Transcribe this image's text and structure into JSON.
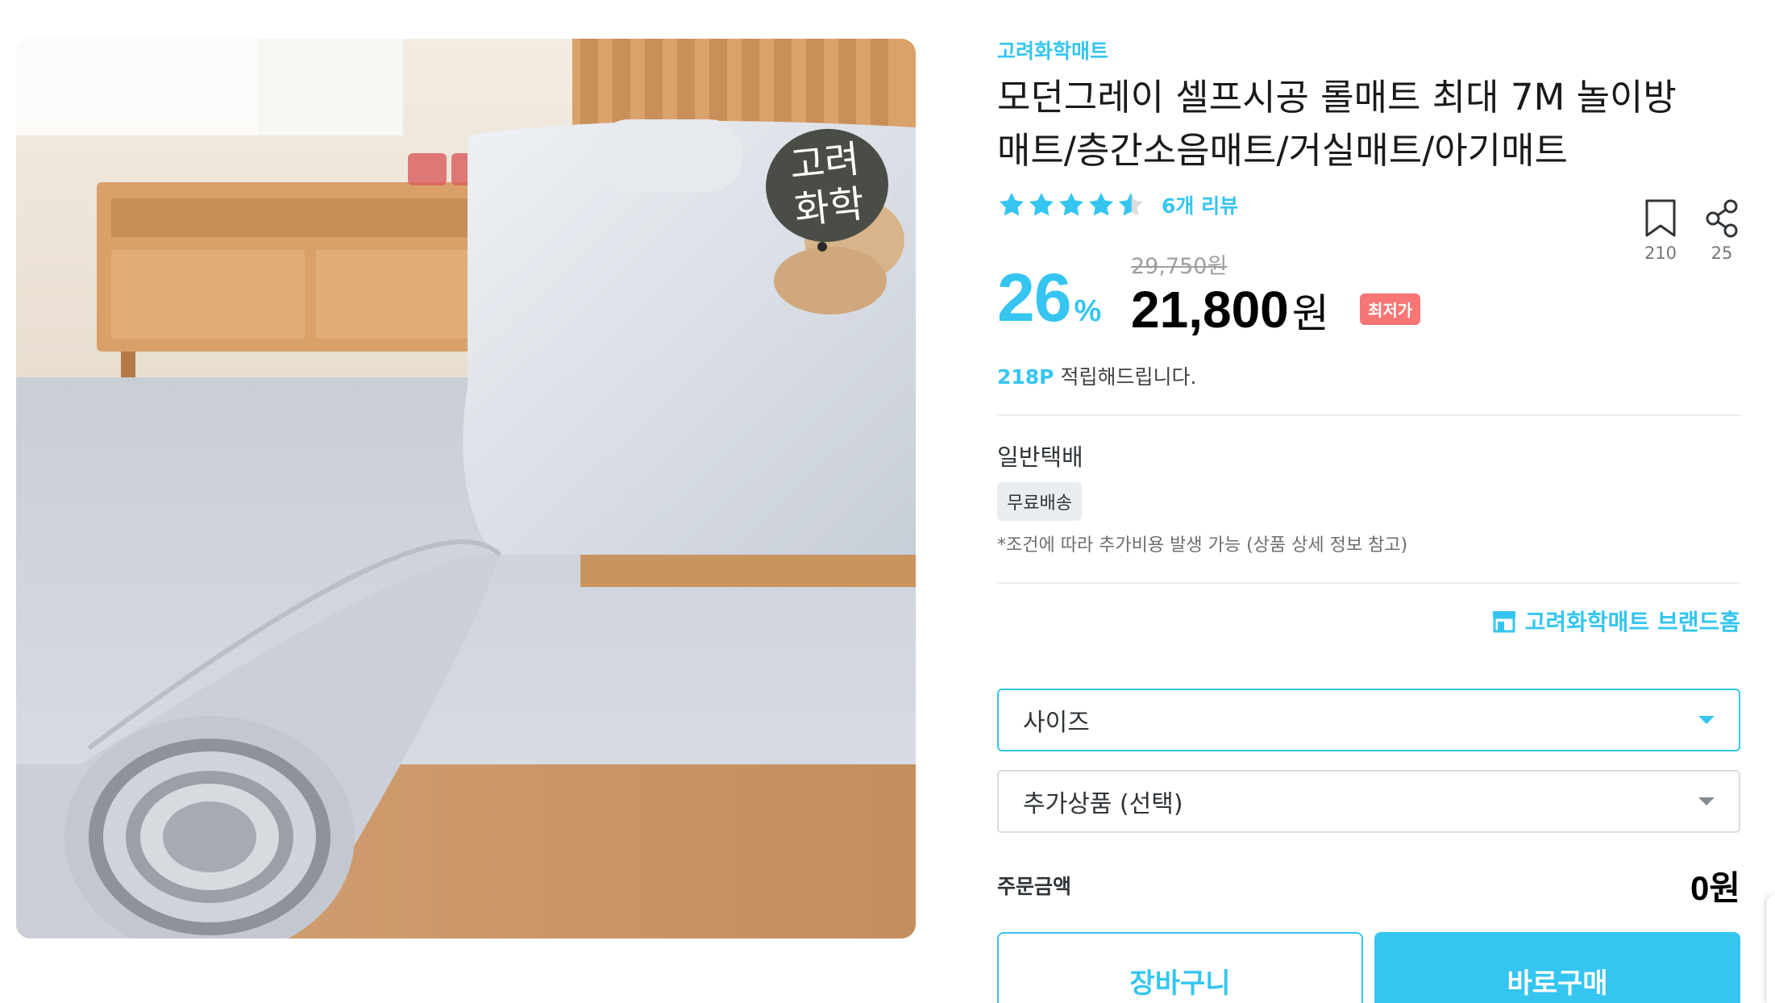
{
  "product_image": {
    "alt": "",
    "sticker_line1": "고려",
    "sticker_line2": "화학"
  },
  "brand": {
    "name": "고려화학매트"
  },
  "product": {
    "title_line1": "모던그레이 셀프시공 롤매트 최대 7M 놀이방",
    "title_line2": "매트/층간소음매트/거실매트/아기매트"
  },
  "rating": {
    "stars": 4.5,
    "review_label": "6개 리뷰"
  },
  "actions": {
    "bookmark_count": "210",
    "share_count": "25"
  },
  "price": {
    "discount": "26",
    "discount_unit": "%",
    "original": "29,750원",
    "sale": "21,800",
    "sale_unit": "원",
    "lowest_badge": "최저가"
  },
  "points": {
    "value": "218P",
    "text": "적립해드립니다."
  },
  "shipping": {
    "type": "일반택배",
    "badge": "무료배송",
    "note": "*조건에 따라 추가비용 발생 가능 (상품 상세 정보 참고)"
  },
  "brand_home": {
    "label": "고려화학매트 브랜드홈"
  },
  "options": {
    "size_label": "사이즈",
    "addon_label": "추가상품 (선택)"
  },
  "order": {
    "label": "주문금액",
    "value": "0원"
  },
  "buttons": {
    "cart": "장바구니",
    "buy": "바로구매"
  },
  "colors": {
    "accent": "#35c5f0",
    "badge_red": "#f77575",
    "sticker": "#4a4d46"
  }
}
